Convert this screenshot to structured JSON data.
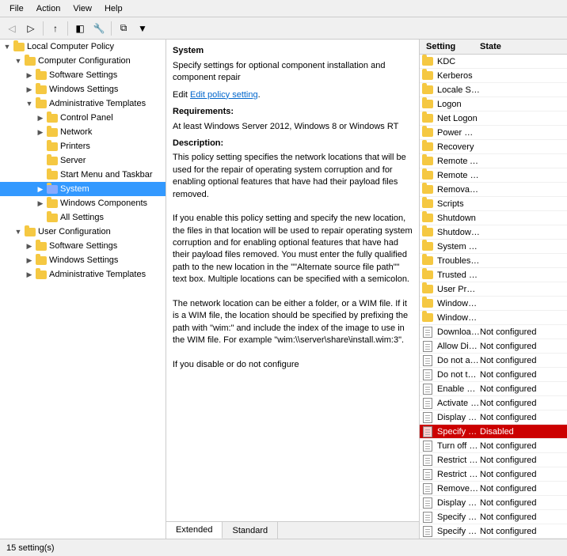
{
  "menubar": {
    "items": [
      "File",
      "Action",
      "View",
      "Help"
    ]
  },
  "toolbar": {
    "buttons": [
      "←",
      "→",
      "↑",
      "⚡",
      "⚡",
      "⚡",
      "▦",
      "≡",
      "⧉",
      "▼"
    ]
  },
  "tree": {
    "title": "Local Computer Policy",
    "items": [
      {
        "id": "local-policy",
        "label": "Local Computer Policy",
        "indent": 0,
        "expanded": true,
        "type": "root"
      },
      {
        "id": "computer-config",
        "label": "Computer Configuration",
        "indent": 1,
        "expanded": true,
        "type": "folder"
      },
      {
        "id": "software-settings",
        "label": "Software Settings",
        "indent": 2,
        "expanded": false,
        "type": "folder"
      },
      {
        "id": "windows-settings",
        "label": "Windows Settings",
        "indent": 2,
        "expanded": false,
        "type": "folder"
      },
      {
        "id": "admin-templates",
        "label": "Administrative Templates",
        "indent": 2,
        "expanded": true,
        "type": "folder"
      },
      {
        "id": "control-panel",
        "label": "Control Panel",
        "indent": 3,
        "expanded": false,
        "type": "folder"
      },
      {
        "id": "network",
        "label": "Network",
        "indent": 3,
        "expanded": false,
        "type": "folder"
      },
      {
        "id": "printers",
        "label": "Printers",
        "indent": 3,
        "expanded": false,
        "type": "folder"
      },
      {
        "id": "server",
        "label": "Server",
        "indent": 3,
        "expanded": false,
        "type": "folder"
      },
      {
        "id": "start-menu",
        "label": "Start Menu and Taskbar",
        "indent": 3,
        "expanded": false,
        "type": "folder"
      },
      {
        "id": "system",
        "label": "System",
        "indent": 3,
        "expanded": false,
        "type": "folder",
        "selected": true
      },
      {
        "id": "windows-components",
        "label": "Windows Components",
        "indent": 3,
        "expanded": false,
        "type": "folder"
      },
      {
        "id": "all-settings",
        "label": "All Settings",
        "indent": 3,
        "expanded": false,
        "type": "folder"
      },
      {
        "id": "user-config",
        "label": "User Configuration",
        "indent": 1,
        "expanded": true,
        "type": "folder"
      },
      {
        "id": "user-software",
        "label": "Software Settings",
        "indent": 2,
        "expanded": false,
        "type": "folder"
      },
      {
        "id": "user-windows",
        "label": "Windows Settings",
        "indent": 2,
        "expanded": false,
        "type": "folder"
      },
      {
        "id": "user-admin",
        "label": "Administrative Templates",
        "indent": 2,
        "expanded": false,
        "type": "folder"
      }
    ]
  },
  "description": {
    "header": "System",
    "subheader": "Specify settings for optional component installation and component repair",
    "edit_link": "Edit policy setting",
    "requirements_title": "Requirements:",
    "requirements_text": "At least Windows Server 2012, Windows 8 or Windows RT",
    "description_title": "Description:",
    "description_text": "This policy setting specifies the network locations that will be used for the repair of operating system corruption and for enabling optional features that have had their payload files removed.\n\nIf you enable this policy setting and specify the new location, the files in that location will be used to repair operating system corruption and for enabling optional features that have had their payload files removed. You must enter the fully qualified path to the new location in the \"\"Alternate source file path\"\" text box. Multiple locations can be specified with a semicolon.\n\nThe network location can be either a folder, or a WIM file. If it is a WIM file, the location should be specified by prefixing the path with \"wim:\" and include the index of the image to use in the WIM file. For example \"wim:\\\\server\\share\\install.wim:3\".\n\nIf you disable or do not configure"
  },
  "settings": {
    "columns": [
      "Setting",
      "State"
    ],
    "items": [
      {
        "name": "KDC",
        "state": "",
        "type": "folder"
      },
      {
        "name": "Kerberos",
        "state": "",
        "type": "folder"
      },
      {
        "name": "Locale Services",
        "state": "",
        "type": "folder"
      },
      {
        "name": "Logon",
        "state": "",
        "type": "folder"
      },
      {
        "name": "Net Logon",
        "state": "",
        "type": "folder"
      },
      {
        "name": "Power Management",
        "state": "",
        "type": "folder"
      },
      {
        "name": "Recovery",
        "state": "",
        "type": "folder"
      },
      {
        "name": "Remote Assistance",
        "state": "",
        "type": "folder"
      },
      {
        "name": "Remote Procedure Call",
        "state": "",
        "type": "folder"
      },
      {
        "name": "Removable Storage Access",
        "state": "",
        "type": "folder"
      },
      {
        "name": "Scripts",
        "state": "",
        "type": "folder"
      },
      {
        "name": "Shutdown",
        "state": "",
        "type": "folder"
      },
      {
        "name": "Shutdown Options",
        "state": "",
        "type": "folder"
      },
      {
        "name": "System Restore",
        "state": "",
        "type": "folder"
      },
      {
        "name": "Troubleshooting and Diagnostics",
        "state": "",
        "type": "folder"
      },
      {
        "name": "Trusted Platform Module Services",
        "state": "",
        "type": "folder"
      },
      {
        "name": "User Profiles",
        "state": "",
        "type": "folder"
      },
      {
        "name": "Windows File Protection",
        "state": "",
        "type": "folder"
      },
      {
        "name": "Windows Time Service",
        "state": "",
        "type": "folder"
      },
      {
        "name": "Download missing COM components",
        "state": "Not configured",
        "type": "policy"
      },
      {
        "name": "Allow Distributed Link Tracking clients to use domain resour...",
        "state": "Not configured",
        "type": "policy"
      },
      {
        "name": "Do not automatically encrypt files moved to encrypted fold...",
        "state": "Not configured",
        "type": "policy"
      },
      {
        "name": "Do not turn off system power after a Windows system shutd...",
        "state": "Not configured",
        "type": "policy"
      },
      {
        "name": "Enable Persistent Time Stamp",
        "state": "Not configured",
        "type": "policy"
      },
      {
        "name": "Activate Shutdown Event Tracker System State Data feature",
        "state": "Not configured",
        "type": "policy"
      },
      {
        "name": "Display Shutdown Event Tracker",
        "state": "Not configured",
        "type": "policy"
      },
      {
        "name": "Specify settings for optional component installation and co...",
        "state": "Disabled",
        "type": "policy",
        "selected": true
      },
      {
        "name": "Turn off Data Execution Prevention for HTML Help Executable",
        "state": "Not configured",
        "type": "policy"
      },
      {
        "name": "Restrict potentially unsafe HTML Help functions to specified...",
        "state": "Not configured",
        "type": "policy"
      },
      {
        "name": "Restrict these programs from being launched from Help",
        "state": "Not configured",
        "type": "policy"
      },
      {
        "name": "Remove Boot / Shutdown / Logon / Logoff status messages",
        "state": "Not configured",
        "type": "policy"
      },
      {
        "name": "Display highly detailed status messages",
        "state": "Not configured",
        "type": "policy"
      },
      {
        "name": "Specify Windows Service Pack installation file location",
        "state": "Not configured",
        "type": "policy"
      },
      {
        "name": "Specify Windows installation file location",
        "state": "Not configured",
        "type": "policy"
      }
    ]
  },
  "tabs": {
    "items": [
      "Extended",
      "Standard"
    ],
    "active": "Extended"
  },
  "statusbar": {
    "text": "15 setting(s)"
  },
  "icons": {
    "folder": "📁",
    "policy": "📄",
    "computer": "🖥"
  }
}
